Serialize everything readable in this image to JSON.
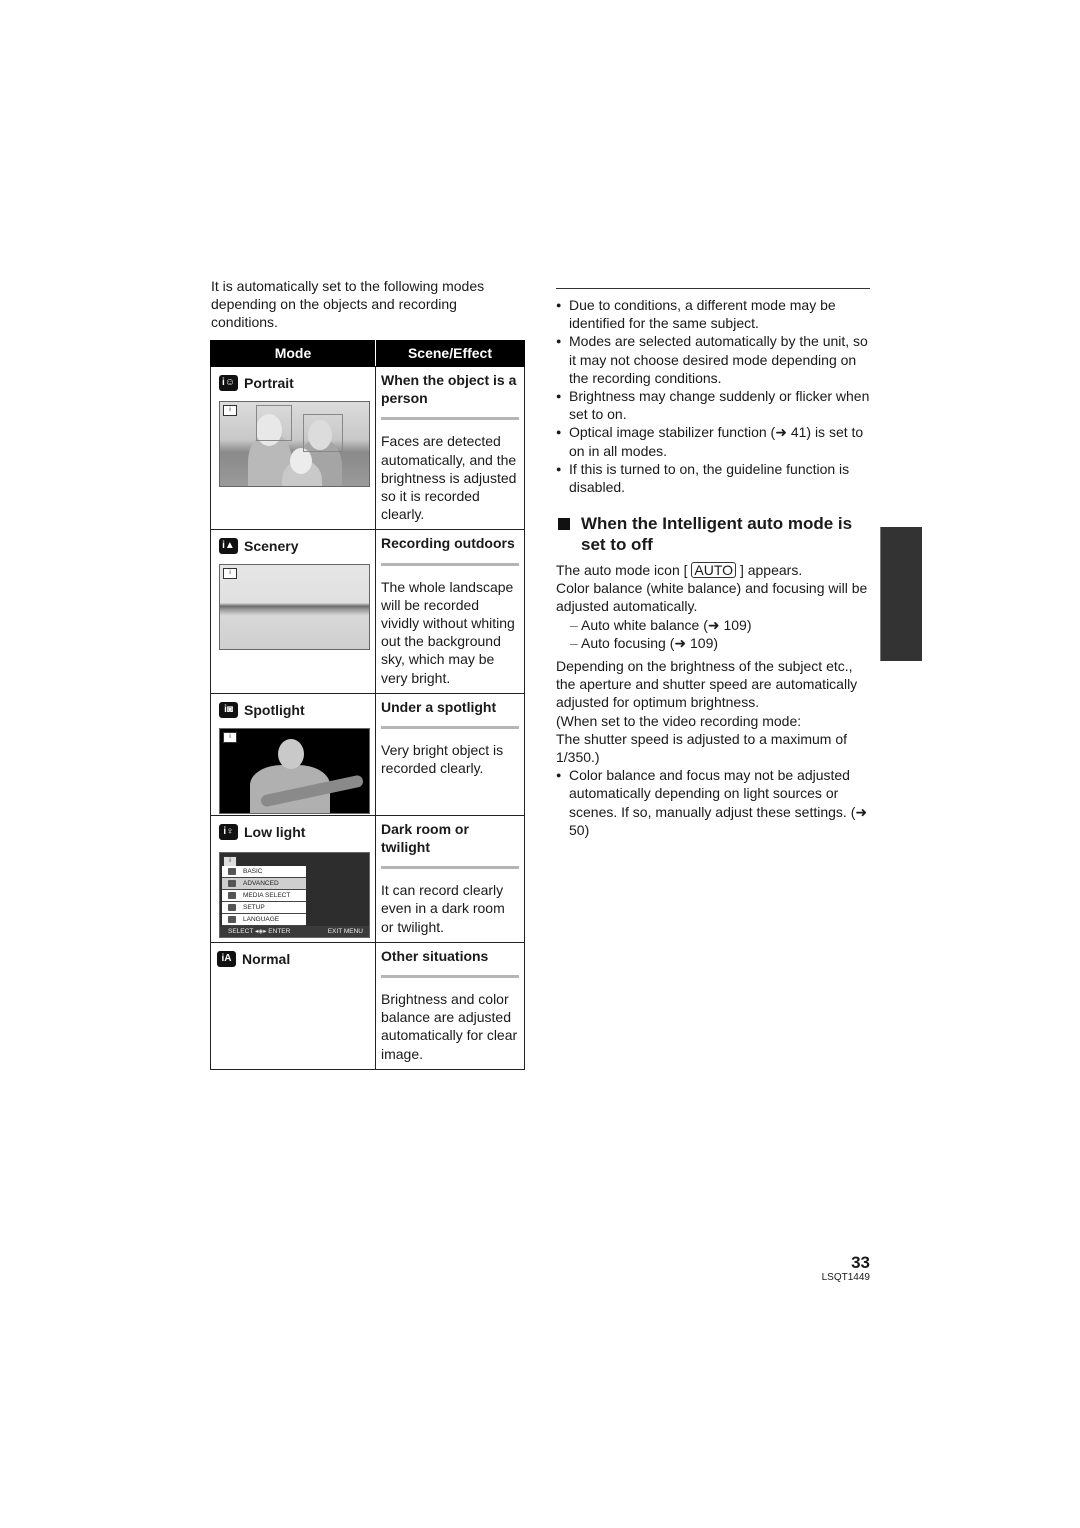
{
  "intro": "It is automatically set to the following modes depending on the objects and recording conditions.",
  "table": {
    "headers": [
      "Mode",
      "Scene/Effect"
    ],
    "rows": [
      {
        "mode": "Portrait",
        "icon": "portrait-mode-icon",
        "icon_glyph": "i☺",
        "effect_title": "When the object is a person",
        "effect_desc": "Faces are detected automatically, and the brightness is adjusted so it is recorded clearly."
      },
      {
        "mode": "Scenery",
        "icon": "scenery-mode-icon",
        "icon_glyph": "i▲",
        "effect_title": "Recording outdoors",
        "effect_desc": "The whole landscape will be recorded vividly without whiting out the background sky, which may be very bright."
      },
      {
        "mode": "Spotlight",
        "icon": "spotlight-mode-icon",
        "icon_glyph": "i◙",
        "effect_title": "Under a spotlight",
        "effect_desc": "Very bright object is recorded clearly."
      },
      {
        "mode": "Low light",
        "icon": "low-light-mode-icon",
        "icon_glyph": "i♀",
        "effect_title": "Dark room or twilight",
        "effect_desc": "It can record clearly even in a dark room or twilight."
      },
      {
        "mode": "Normal",
        "icon": "normal-mode-icon",
        "icon_glyph": "iA",
        "effect_title": "Other situations",
        "effect_desc": "Brightness and color balance are adjusted automatically for clear image."
      }
    ],
    "menu_screen": {
      "items": [
        "BASIC",
        "ADVANCED",
        "MEDIA SELECT",
        "SETUP",
        "LANGUAGE"
      ],
      "selected": "ADVANCED",
      "footer_left": "SELECT ◂◈▸ ENTER",
      "footer_right": "EXIT MENU"
    }
  },
  "notes": [
    "Due to conditions, a different mode may be identified for the same subject.",
    "Modes are selected automatically by the unit, so it may not choose desired mode depending on the recording conditions.",
    "Brightness may change suddenly or flicker when set to on.",
    "Optical image stabilizer function (➜ 41) is set to on in all modes.",
    "If this is turned to on, the guideline function is disabled."
  ],
  "section": {
    "heading": "When the Intelligent auto mode is set to off",
    "auto_line_pre": "The auto mode icon [",
    "auto_icon": "AUTO",
    "auto_line_post": "] appears.",
    "color_line": "Color balance (white balance) and focusing will be adjusted automatically.",
    "sub_items": [
      "Auto white balance (➜ 109)",
      "Auto focusing (➜ 109)"
    ],
    "depend_para": "Depending on the brightness of the subject etc., the aperture and shutter speed are automatically adjusted for optimum brightness.",
    "video_note_1": "(When set to the video recording mode:",
    "video_note_2": "The shutter speed is adjusted to a maximum of 1/350.)",
    "final_note": "Color balance and focus may not be adjusted automatically depending on light sources or scenes. If so, manually adjust these settings. (➜ 50)"
  },
  "footer": {
    "page_number": "33",
    "doc_code": "LSQT1449"
  }
}
